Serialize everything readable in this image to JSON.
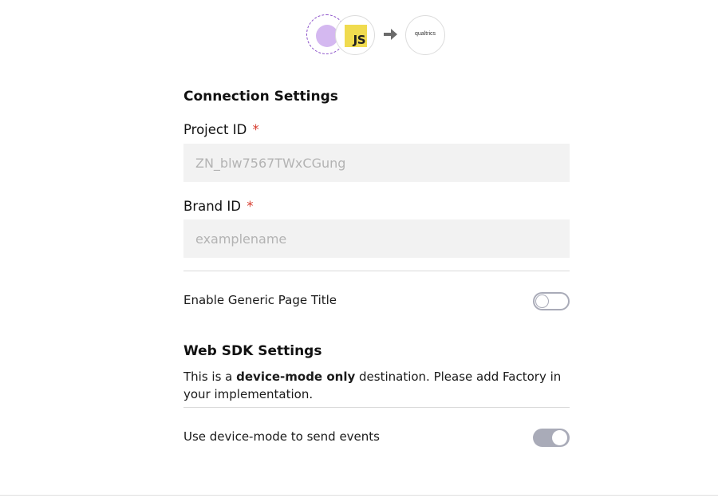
{
  "header": {
    "source_icon": "source-avatar-icon",
    "library_icon": "javascript-icon",
    "library_badge_text": "JS",
    "arrow_icon": "arrow-right-icon",
    "destination_icon": "qualtrics-logo",
    "destination_logo_text": "qualtrics",
    "colors": {
      "source_dashed_border": "#8a4fc9",
      "source_fill": "#d4b8f0",
      "js_badge": "#f0db4f",
      "arrow": "#6b6b6b"
    }
  },
  "connection_settings": {
    "title": "Connection Settings",
    "project_id": {
      "label": "Project ID",
      "required_mark": "*",
      "value": "",
      "placeholder": "ZN_blw7567TWxCGung"
    },
    "brand_id": {
      "label": "Brand ID",
      "required_mark": "*",
      "value": "",
      "placeholder": "examplename"
    },
    "generic_page_title": {
      "label": "Enable Generic Page Title",
      "enabled": false
    }
  },
  "web_sdk_settings": {
    "title": "Web SDK Settings",
    "description_prefix": "This is a ",
    "description_bold": "device-mode only",
    "description_suffix": " destination. Please add Factory in your implementation.",
    "device_mode": {
      "label": "Use device-mode to send events",
      "enabled": true
    }
  },
  "colors": {
    "required": "#d6392b",
    "input_background": "#f2f2f2",
    "placeholder": "#b3b3b3",
    "toggle": "#a9abb8",
    "divider": "#dadada"
  }
}
